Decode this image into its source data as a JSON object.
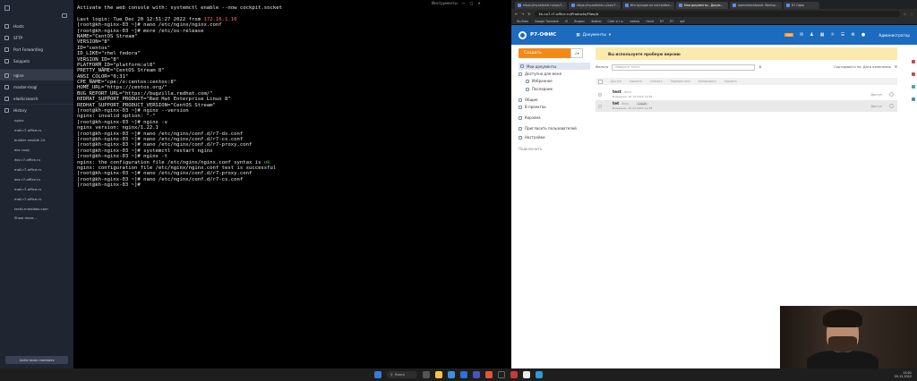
{
  "sidebar": {
    "nav": [
      {
        "label": "Hosts",
        "icon": "hosts-icon"
      },
      {
        "label": "SFTP",
        "icon": "sftp-icon"
      },
      {
        "label": "Port Forwarding",
        "icon": "port-forwarding-icon"
      },
      {
        "label": "Snippets",
        "icon": "snippets-icon"
      }
    ],
    "hosts": [
      "nginx",
      "master-mogi",
      "elasticsearch"
    ],
    "history_label": "History",
    "history": [
      "nginx",
      "mail.r7-office.ru",
      "builder ansible 24",
      "doc copy",
      "doc.r7-office.ru",
      "mail.r7-office.ru",
      "doc.r7-office.ru",
      "mail.r7-office.ru",
      "mail.r7-office.ru",
      "mail.r7-office.ru",
      "techt.mindlabs.com"
    ],
    "show_more": "Show more...",
    "bottom_button": "Invite team members"
  },
  "terminal": {
    "controls": [
      "Инструменты",
      "—",
      "□",
      "✕"
    ],
    "lines": [
      "Activate the web console with: systemctl enable --now cockpit.socket",
      "",
      "Last login: Tue Dec 20 12:51:27 2022 from ",
      "[root@kh-nginx-03 ~]# nano /etc/nginx/nginx.conf",
      "[root@kh-nginx-03 ~]# more /etc/os-release",
      "NAME=\"CentOS Stream\"",
      "VERSION=\"8\"",
      "ID=\"centos\"",
      "ID_LIKE=\"rhel fedora\"",
      "VERSION_ID=\"8\"",
      "PLATFORM_ID=\"platform:el8\"",
      "PRETTY_NAME=\"CentOS Stream 8\"",
      "ANSI_COLOR=\"0;31\"",
      "CPE_NAME=\"cpe:/o:centos:centos:8\"",
      "HOME_URL=\"https://centos.org/\"",
      "BUG_REPORT_URL=\"https://bugzilla.redhat.com/\"",
      "REDHAT_SUPPORT_PRODUCT=\"Red Hat Enterprise Linux 8\"",
      "REDHAT_SUPPORT_PRODUCT_VERSION=\"CentOS Stream\"",
      "[root@kh-nginx-03 ~]# nginx --version",
      "nginx: invalid option: \"-\"",
      "[root@kh-nginx-03 ~]# nginx -v",
      "nginx version: nginx/1.22.1",
      "[root@kh-nginx-03 ~]# nano /etc/nginx/conf.d/r7-ds.conf",
      "[root@kh-nginx-03 ~]# nano /etc/nginx/conf.d/r7-cs.conf",
      "[root@kh-nginx-03 ~]# nano /etc/nginx/conf.d/r7-proxy.conf",
      "[root@kh-nginx-03 ~]# systemctl restart nginx",
      "[root@kh-nginx-03 ~]# nginx -t",
      "nginx: the configuration file /etc/nginx/nginx.conf syntax is ",
      "nginx: configuration file /etc/nginx/nginx.conf test is successful",
      "[root@kh-nginx-03 ~]# nano /etc/nginx/conf.d/r7-proxy.conf",
      "[root@kh-nginx-03 ~]# nano /etc/nginx/conf.d/r7-cs.conf",
      "[root@kh-nginx-03 ~]# "
    ],
    "login_ip": "172.16.1.10",
    "syntax_ok": "ok"
  },
  "browser": {
    "tabs": [
      "https://my.selectel.ru/vpc/7...",
      "https://my.selectel.ru/vpc/7...",
      "Инструкция по настройке...",
      "Мои документы - Докум...",
      "openerdashboard: Worksp...",
      "R7 Офис"
    ],
    "url": "kh-co7-r7-office.ru/Products/Files/#",
    "bookmarks": [
      "YouTube",
      "Google Translate",
      "rS",
      "Яндекс",
      "Файлы",
      "Сайт и т.к.",
      "salesis",
      "cloud",
      "R7",
      "R7",
      "apt"
    ]
  },
  "r7": {
    "logo": "Р7-ОФИС",
    "section": "Документы",
    "user": "Администратор",
    "badge": "new",
    "create": "Создать",
    "nav": [
      {
        "label": "Мои документы",
        "sel": true,
        "sub": false
      },
      {
        "label": "Доступно для меня",
        "sel": false,
        "sub": false
      },
      {
        "label": "Избранное",
        "sel": false,
        "sub": true
      },
      {
        "label": "Последние",
        "sel": false,
        "sub": true
      },
      {
        "label": "Общие",
        "sel": false,
        "sub": false
      },
      {
        "label": "В проектах",
        "sel": false,
        "sub": false
      },
      {
        "label": "Корзина",
        "sel": false,
        "sub": false
      },
      {
        "label": "Пригласить пользователей",
        "sel": false,
        "sub": false
      },
      {
        "label": "Настройки",
        "sel": false,
        "sub": false
      },
      {
        "label": "Подключить",
        "sel": false,
        "sub": false
      }
    ],
    "banner": "Вы используете пробную версию",
    "filter_label": "Фильтр",
    "filter_placeholder": "Введите текст",
    "sort": "Сортировать по: Дата изменения",
    "columns": [
      "Доступ",
      "Удалить",
      "Скачать",
      "Переместить",
      "Копировать",
      "Удалить"
    ],
    "files": [
      {
        "name": "test",
        "ext": ".docx",
        "meta": "Изменено: 20.12.2022 12:58",
        "tag": "",
        "access": "Доступ"
      },
      {
        "name": "tet",
        "ext": ".docx",
        "meta": "Изменено: 20.12.2022 12:58",
        "tag": "новый",
        "access": "Доступ"
      }
    ]
  },
  "taskbar": {
    "search": "Поиск",
    "time": "13:01",
    "date": "20.12.2022"
  }
}
